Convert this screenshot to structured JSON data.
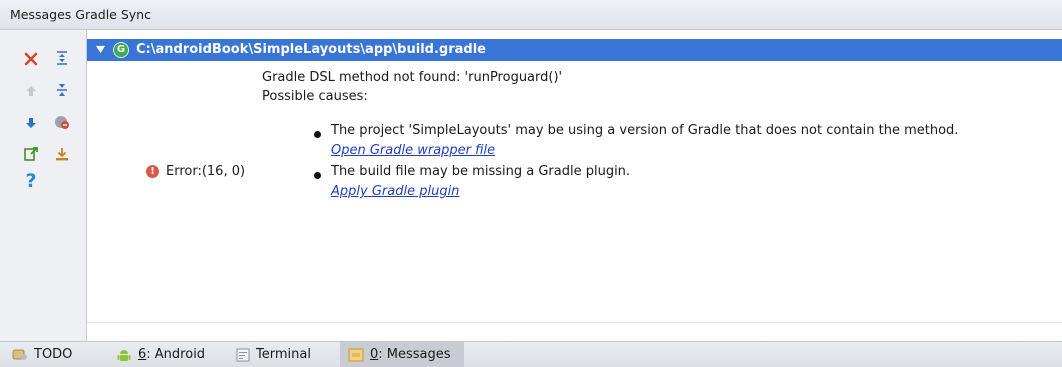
{
  "window": {
    "title": "Messages Gradle Sync"
  },
  "toolbar": {
    "buttons": [
      {
        "icon": "close-icon"
      },
      {
        "icon": "expand-all-icon"
      },
      {
        "icon": "up-arrow-icon"
      },
      {
        "icon": "collapse-all-icon"
      },
      {
        "icon": "down-arrow-icon"
      },
      {
        "icon": "error-filter-icon"
      },
      {
        "icon": "export-icon"
      },
      {
        "icon": "autoscroll-icon"
      },
      {
        "icon": "help-icon"
      }
    ]
  },
  "tree": {
    "file_path": "C:\\androidBook\\SimpleLayouts\\app\\build.gradle",
    "file_icon_letter": "G"
  },
  "message": {
    "line1": "Gradle DSL method not found: 'runProguard()'",
    "line2": "Possible causes:",
    "error_label": "Error:(16, 0)",
    "cause1": "The project 'SimpleLayouts' may be using a version of Gradle that does not contain the method.",
    "link1": "Open Gradle wrapper file",
    "cause2": "The build file may be missing a Gradle plugin.",
    "link2": "Apply Gradle plugin"
  },
  "statusbar": {
    "tabs": [
      {
        "label": "TODO",
        "number": ""
      },
      {
        "label": ": Android",
        "number": "6"
      },
      {
        "label": "Terminal",
        "number": ""
      },
      {
        "label": ": Messages",
        "number": "0",
        "active": true
      }
    ]
  },
  "colors": {
    "selection": "#3875d6",
    "link": "#1f3fbf",
    "error": "#d65a4a",
    "gradle": "#3bae52"
  }
}
